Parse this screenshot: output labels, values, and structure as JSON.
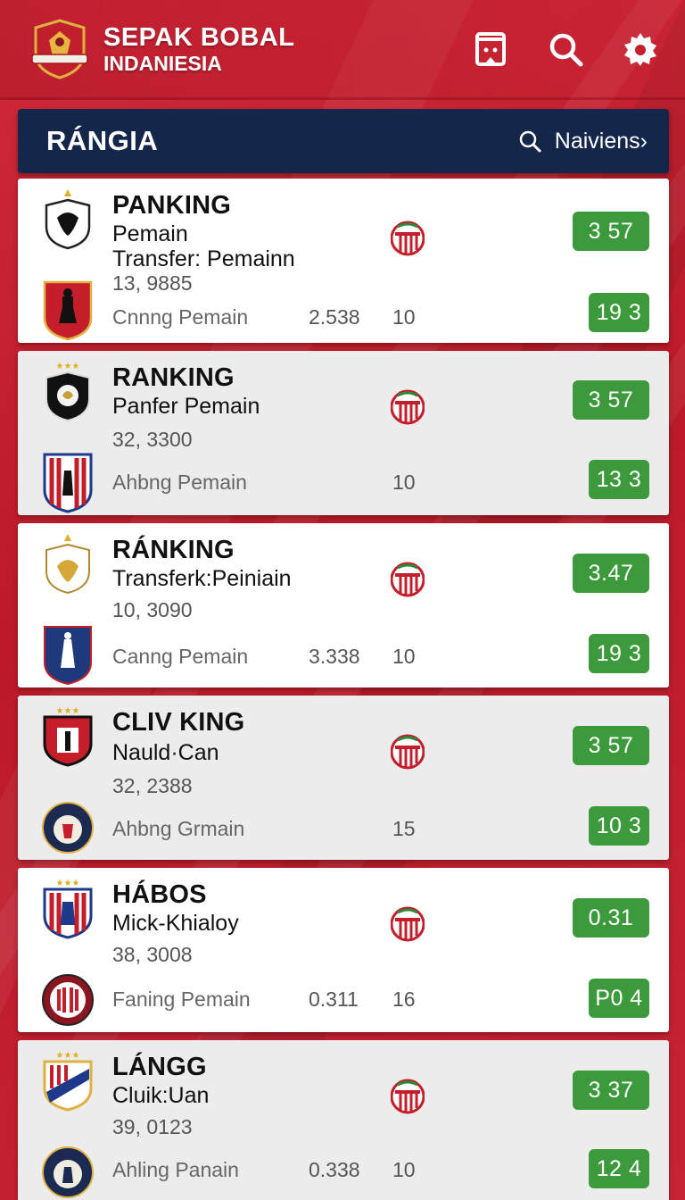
{
  "header": {
    "brand_title": "SEPAK BOBAL",
    "brand_sub": "INDANIESIA",
    "icons": [
      "phone-icon",
      "search-icon",
      "settings-gear-icon"
    ]
  },
  "title_bar": {
    "title": "RÁNGIA",
    "nav_label": "Naiviens›"
  },
  "colors": {
    "brand_red": "#c81f2d",
    "navy": "#14274a",
    "score_green": "#3d9a3c"
  },
  "cards": [
    {
      "title": "PANKING",
      "line1": "Pemain",
      "line2": "Transfer: Pemainn",
      "number": "13, 9885",
      "footer_label": "Cnnng Pemain",
      "footer_value": "2.538",
      "footer_num": "10",
      "score_top": "3 57",
      "score_bottom": "19  3"
    },
    {
      "title": "RANKING",
      "line1": "Panfer Pemain",
      "line2": "",
      "number": "32, 3300",
      "footer_label": "Ahbng Pemain",
      "footer_value": "",
      "footer_num": "10",
      "score_top": "3 57",
      "score_bottom": "13  3"
    },
    {
      "title": "RÁNKING",
      "line1": "Transferk:Peiniain",
      "line2": "",
      "number": "10, 3090",
      "footer_label": "Canng Pemain",
      "footer_value": "3.338",
      "footer_num": "10",
      "score_top": "3.47",
      "score_bottom": "19  3"
    },
    {
      "title": "CLIV KING",
      "line1": "Nauld·Can",
      "line2": "",
      "number": "32, 2388",
      "footer_label": "Ahbng Grmain",
      "footer_value": "",
      "footer_num": "15",
      "score_top": "3 57",
      "score_bottom": "10  3"
    },
    {
      "title": "HÁBOS",
      "line1": "Mick-Khialoy",
      "line2": "",
      "number": "38, 3008",
      "footer_label": "Faning Pemain",
      "footer_value": "0.311",
      "footer_num": "16",
      "score_top": "0.31",
      "score_bottom": "P0  4"
    },
    {
      "title": "LÁNGG",
      "line1": "Cluik:Uan",
      "line2": "",
      "number": "39, 0123",
      "footer_label": "Ahling Panain",
      "footer_value": "0.338",
      "footer_num": "10",
      "score_top": "3 37",
      "score_bottom": "12  4"
    }
  ]
}
